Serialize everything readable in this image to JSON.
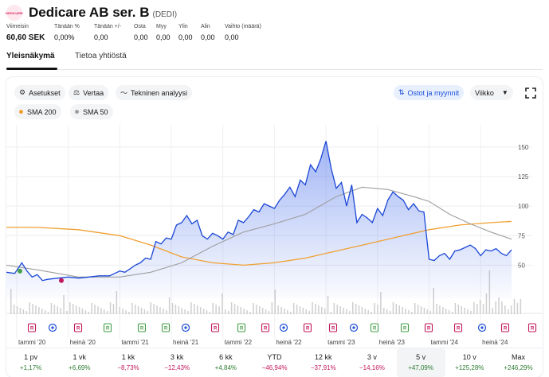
{
  "header": {
    "logo_text": "DEDICARE",
    "title": "Dedicare AB ser. B",
    "ticker": "(DEDI)"
  },
  "stats": [
    {
      "label": "Viimeisin",
      "value": "60,60 SEK"
    },
    {
      "label": "Tänään %",
      "value": "0,00%"
    },
    {
      "label": "Tänään +/-",
      "value": "0,00"
    },
    {
      "label": "Osta",
      "value": "0,00"
    },
    {
      "label": "Myy",
      "value": "0,00"
    },
    {
      "label": "Ylin",
      "value": "0,00"
    },
    {
      "label": "Alin",
      "value": "0,00"
    },
    {
      "label": "Vaihto (määrä)",
      "value": "0,00"
    }
  ],
  "tabs": [
    {
      "label": "Yleisnäkymä",
      "active": true
    },
    {
      "label": "Tietoa yhtiöstä",
      "active": false
    }
  ],
  "toolbar": {
    "settings_label": "Asetukset",
    "compare_label": "Vertaa",
    "technical_label": "Tekninen analyysi",
    "buy_sell_label": "Ostot ja myynnit",
    "interval_label": "Viikko",
    "sma200_label": "SMA 200",
    "sma50_label": "SMA 50"
  },
  "colors": {
    "price_line": "#1a47d6",
    "sma200": "#f0a030",
    "sma50": "#9e9e9e",
    "positive": "#2e7d32",
    "negative": "#c2185b",
    "accent": "#1d4fd8"
  },
  "chart_data": {
    "type": "line",
    "y_ticks": [
      50,
      75,
      100,
      125,
      150
    ],
    "ylim": [
      22,
      162
    ],
    "x_labels": [
      "tammi '20",
      "heinä '20",
      "tammi '21",
      "heinä '21",
      "tammi '22",
      "heinä '22",
      "tammi '23",
      "heinä '23",
      "tammi '24",
      "heinä '24"
    ],
    "xlim": [
      2019.9,
      2024.8
    ],
    "grid": true,
    "series": [
      {
        "name": "",
        "x": [
          2019.9,
          2019.98,
          2020.05,
          2020.1,
          2020.15,
          2020.2,
          2020.25,
          2020.3,
          2020.4,
          2020.5,
          2020.6,
          2020.7,
          2020.8,
          2020.9,
          2021.0,
          2021.05,
          2021.1,
          2021.15,
          2021.2,
          2021.25,
          2021.3,
          2021.35,
          2021.4,
          2021.45,
          2021.5,
          2021.55,
          2021.6,
          2021.65,
          2021.7,
          2021.75,
          2021.8,
          2021.85,
          2021.9,
          2021.95,
          2022.0,
          2022.05,
          2022.1,
          2022.15,
          2022.2,
          2022.25,
          2022.3,
          2022.35,
          2022.4,
          2022.45,
          2022.5,
          2022.55,
          2022.6,
          2022.65,
          2022.7,
          2022.75,
          2022.8,
          2022.85,
          2022.9,
          2022.95,
          2023.0,
          2023.05,
          2023.1,
          2023.15,
          2023.2,
          2023.25,
          2023.3,
          2023.35,
          2023.4,
          2023.45,
          2023.5,
          2023.55,
          2023.6,
          2023.65,
          2023.7,
          2023.75,
          2023.8,
          2023.85,
          2023.9,
          2023.95,
          2024.0,
          2024.05,
          2024.1,
          2024.15,
          2024.2,
          2024.25,
          2024.3,
          2024.35,
          2024.4,
          2024.45,
          2024.5,
          2024.55,
          2024.6,
          2024.65,
          2024.7,
          2024.75,
          2024.8
        ],
        "y": [
          44,
          43,
          52,
          45,
          40,
          42,
          37,
          38,
          39,
          40,
          39,
          40,
          41,
          41,
          45,
          44,
          47,
          50,
          52,
          56,
          55,
          70,
          68,
          73,
          72,
          84,
          86,
          92,
          85,
          88,
          75,
          72,
          77,
          75,
          72,
          78,
          76,
          88,
          86,
          91,
          97,
          95,
          102,
          100,
          98,
          105,
          110,
          116,
          108,
          122,
          118,
          135,
          129,
          140,
          155,
          132,
          115,
          120,
          100,
          118,
          86,
          93,
          90,
          86,
          98,
          92,
          105,
          112,
          108,
          105,
          97,
          102,
          96,
          95,
          55,
          54,
          58,
          60,
          55,
          62,
          63,
          65,
          67,
          64,
          58,
          63,
          62,
          64,
          60,
          58,
          63
        ]
      },
      {
        "name": "SMA 200",
        "x": [
          2019.9,
          2020.2,
          2020.6,
          2021.0,
          2021.3,
          2021.6,
          2021.9,
          2022.2,
          2022.5,
          2022.8,
          2023.1,
          2023.4,
          2023.7,
          2024.0,
          2024.3,
          2024.6,
          2024.8
        ],
        "y": [
          82,
          82,
          80,
          75,
          67,
          57,
          52,
          50,
          52,
          56,
          62,
          68,
          74,
          80,
          84,
          86,
          87
        ]
      },
      {
        "name": "SMA 50",
        "x": [
          2019.9,
          2020.2,
          2020.6,
          2021.0,
          2021.3,
          2021.6,
          2021.9,
          2022.2,
          2022.5,
          2022.8,
          2023.1,
          2023.35,
          2023.6,
          2023.85,
          2024.0,
          2024.2,
          2024.4,
          2024.6,
          2024.8
        ],
        "y": [
          50,
          46,
          40,
          40,
          44,
          52,
          66,
          78,
          85,
          93,
          108,
          116,
          114,
          108,
          104,
          93,
          85,
          78,
          72
        ]
      }
    ]
  },
  "periods": [
    {
      "label": "1 pv",
      "value": "+1,17%",
      "sign": "pos"
    },
    {
      "label": "1 vk",
      "value": "+6,69%",
      "sign": "pos"
    },
    {
      "label": "1 kk",
      "value": "−8,73%",
      "sign": "neg"
    },
    {
      "label": "3 kk",
      "value": "−12,43%",
      "sign": "neg"
    },
    {
      "label": "6 kk",
      "value": "+4,84%",
      "sign": "pos"
    },
    {
      "label": "YTD",
      "value": "−46,94%",
      "sign": "neg"
    },
    {
      "label": "12 kk",
      "value": "−37,91%",
      "sign": "neg"
    },
    {
      "label": "3 v",
      "value": "−14,16%",
      "sign": "neg"
    },
    {
      "label": "5 v",
      "value": "+47,09%",
      "sign": "pos",
      "active": true
    },
    {
      "label": "10 v",
      "value": "+125,28%",
      "sign": "pos"
    },
    {
      "label": "Max",
      "value": "+246,29%",
      "sign": "pos"
    }
  ]
}
